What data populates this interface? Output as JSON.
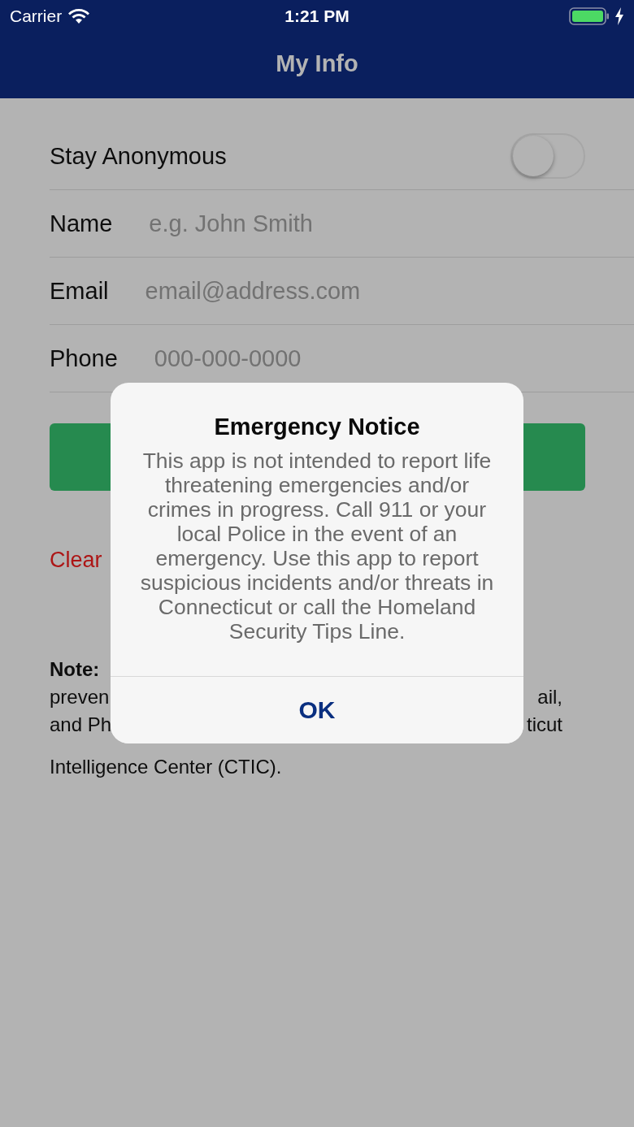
{
  "status_bar": {
    "carrier": "Carrier",
    "time": "1:21 PM"
  },
  "nav": {
    "title": "My Info"
  },
  "anonymous": {
    "label": "Stay Anonymous",
    "on": false
  },
  "fields": [
    {
      "label": "Name",
      "placeholder": "e.g. John Smith"
    },
    {
      "label": "Email",
      "placeholder": "email@address.com"
    },
    {
      "label": "Phone",
      "placeholder": "000-000-0000"
    }
  ],
  "clear_link": "Clear",
  "note_lines": [
    {
      "start": "**Note:**"
    },
    {
      "start": "preven",
      "end": "ail,"
    },
    {
      "start": "and Ph",
      "end": "ticut"
    },
    {
      "start": "Intelligence Center (CTIC)."
    }
  ],
  "alert": {
    "title": "Emergency Notice",
    "message": "This app is not intended to report life threatening emergencies and/or crimes in progress. Call 911 or your local Police in the event of an emergency. Use this app to report suspicious incidents and/or threats in Connecticut or call the Homeland Security Tips Line.",
    "button": "OK"
  }
}
